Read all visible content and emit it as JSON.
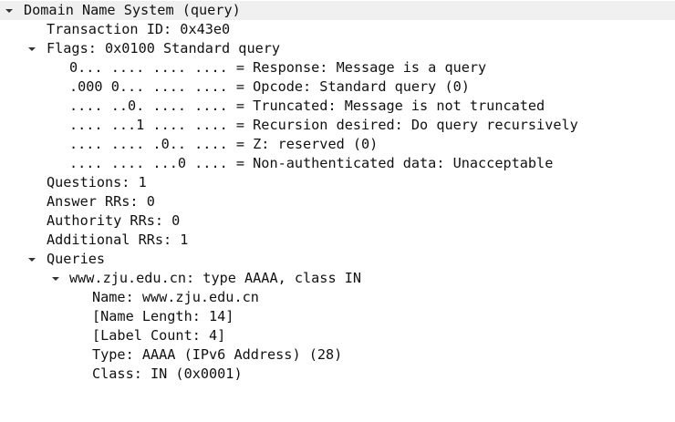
{
  "tree": {
    "dns": "Domain Name System (query)",
    "transaction_id": "Transaction ID: 0x43e0",
    "flags": {
      "label": "Flags: 0x0100 Standard query",
      "response": "0... .... .... .... = Response: Message is a query",
      "opcode": ".000 0... .... .... = Opcode: Standard query (0)",
      "truncated": ".... ..0. .... .... = Truncated: Message is not truncated",
      "recursion": ".... ...1 .... .... = Recursion desired: Do query recursively",
      "z": ".... .... .0.. .... = Z: reserved (0)",
      "non_auth": ".... .... ...0 .... = Non-authenticated data: Unacceptable"
    },
    "questions": "Questions: 1",
    "answer_rrs": "Answer RRs: 0",
    "authority_rrs": "Authority RRs: 0",
    "additional_rrs": "Additional RRs: 1",
    "queries": {
      "label": "Queries",
      "entry": {
        "label": "www.zju.edu.cn: type AAAA, class IN",
        "name": "Name: www.zju.edu.cn",
        "name_length": "[Name Length: 14]",
        "label_count": "[Label Count: 4]",
        "type": "Type: AAAA (IPv6 Address) (28)",
        "class": "Class: IN (0x0001)"
      }
    }
  },
  "icons": {
    "expanded": "chevron-down-icon"
  },
  "colors": {
    "text": "#111111",
    "selected_row_bg": "#f0f0f0",
    "arrow": "#333333"
  }
}
